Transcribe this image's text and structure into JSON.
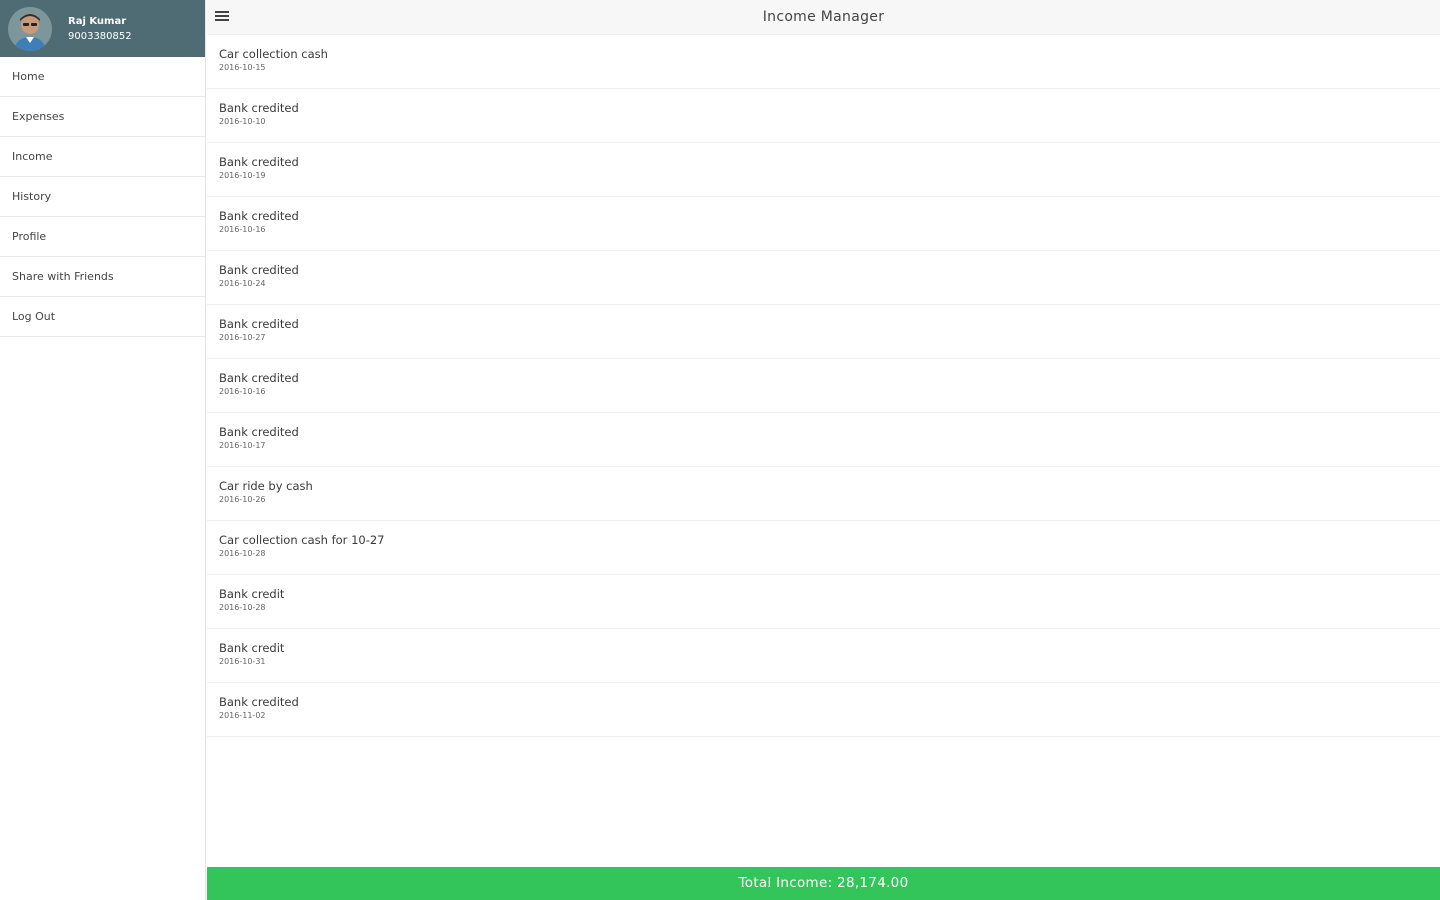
{
  "user": {
    "name": "Raj Kumar",
    "phone": "9003380852"
  },
  "menu": [
    {
      "label": "Home"
    },
    {
      "label": "Expenses"
    },
    {
      "label": "Income"
    },
    {
      "label": "History"
    },
    {
      "label": "Profile"
    },
    {
      "label": "Share with Friends"
    },
    {
      "label": "Log Out"
    }
  ],
  "header": {
    "title": "Income Manager"
  },
  "income_items": [
    {
      "title": "Car collection cash",
      "date": "2016-10-15"
    },
    {
      "title": "Bank credited",
      "date": "2016-10-10"
    },
    {
      "title": "Bank credited",
      "date": "2016-10-19"
    },
    {
      "title": "Bank credited",
      "date": "2016-10-16"
    },
    {
      "title": "Bank credited",
      "date": "2016-10-24"
    },
    {
      "title": "Bank credited",
      "date": "2016-10-27"
    },
    {
      "title": "Bank credited",
      "date": "2016-10-16"
    },
    {
      "title": "Bank credited",
      "date": "2016-10-17"
    },
    {
      "title": "Car ride by cash",
      "date": "2016-10-26"
    },
    {
      "title": "Car collection cash for 10-27",
      "date": "2016-10-28"
    },
    {
      "title": "Bank credit",
      "date": "2016-10-28"
    },
    {
      "title": "Bank credit",
      "date": "2016-10-31"
    },
    {
      "title": "Bank credited",
      "date": "2016-11-02"
    }
  ],
  "footer": {
    "total_text": "Total Income: 28,174.00"
  },
  "colors": {
    "profile_bg": "#4f6b73",
    "footer_bg": "#33c45a",
    "header_bg": "#f7f7f7"
  },
  "icons": {
    "menu": "hamburger-icon",
    "avatar": "user-avatar"
  }
}
